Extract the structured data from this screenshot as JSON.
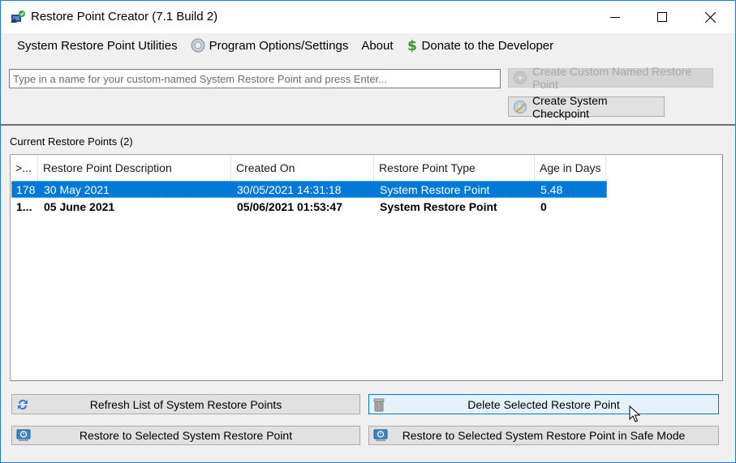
{
  "window": {
    "title": "Restore Point Creator (7.1 Build 2)",
    "app_icon": "restore-point-creator-icon",
    "controls": [
      "minimize-icon",
      "maximize-icon",
      "close-icon"
    ]
  },
  "menu": [
    {
      "label": "System Restore Point Utilities",
      "icon": null
    },
    {
      "label": "Program Options/Settings",
      "icon": "gear-icon"
    },
    {
      "label": "About",
      "icon": null
    },
    {
      "label": "Donate to the Developer",
      "icon": "dollar-icon"
    }
  ],
  "create_panel": {
    "name_input": {
      "value": "",
      "placeholder": "Type in a name for your custom-named System Restore Point and press Enter..."
    },
    "create_custom_button": {
      "label": "Create Custom Named Restore Point",
      "enabled": false
    },
    "create_checkpoint_button": {
      "label": "Create System Checkpoint",
      "enabled": true
    }
  },
  "restore_points": {
    "section_label": "Current Restore Points (2)",
    "columns": [
      ">...",
      "Restore Point Description",
      "Created On",
      "Restore Point Type",
      "Age in Days"
    ],
    "rows": [
      {
        "id": "178",
        "description": "30 May 2021",
        "created_on": "30/05/2021 14:31:18",
        "type": "System Restore Point",
        "age_days": "5.48",
        "selected": true,
        "bold": false
      },
      {
        "id": "1...",
        "description": "05 June 2021",
        "created_on": "05/06/2021 01:53:47",
        "type": "System Restore Point",
        "age_days": "0",
        "selected": false,
        "bold": true
      }
    ]
  },
  "actions": {
    "refresh": {
      "label": "Refresh List of System Restore Points",
      "icon": "refresh-icon"
    },
    "delete": {
      "label": "Delete Selected Restore Point",
      "icon": "trash-icon"
    },
    "restore": {
      "label": "Restore to Selected System Restore Point",
      "icon": "restore-icon"
    },
    "restore_safe_mode": {
      "label": "Restore to Selected System Restore Point in Safe Mode",
      "icon": "restore-icon"
    }
  },
  "colors": {
    "selection": "#0078d7",
    "window_border": "#1f7fd8",
    "hover_button": "#e5f1fb"
  }
}
